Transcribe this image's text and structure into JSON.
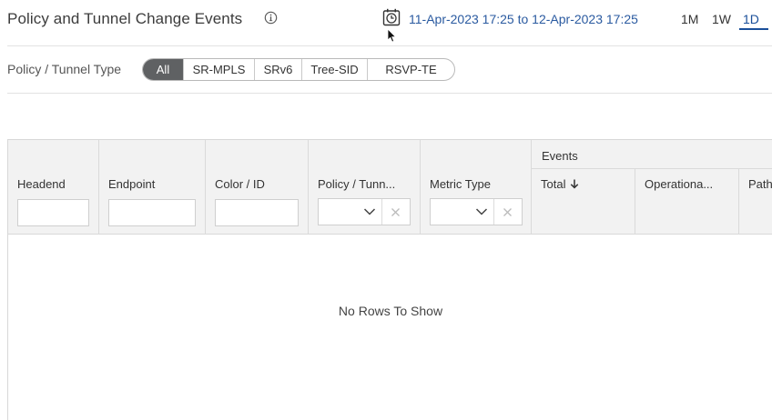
{
  "header": {
    "title": "Policy and Tunnel Change Events",
    "date_range": "11-Apr-2023 17:25 to 12-Apr-2023 17:25",
    "range_buttons": [
      "1M",
      "1W",
      "1D"
    ],
    "active_range": "1D"
  },
  "filter": {
    "label": "Policy / Tunnel Type",
    "options": [
      "All",
      "SR-MPLS",
      "SRv6",
      "Tree-SID",
      "RSVP-TE"
    ],
    "selected": "All"
  },
  "table": {
    "columns": {
      "headend": "Headend",
      "endpoint": "Endpoint",
      "color_id": "Color / ID",
      "policy_type": "Policy / Tunn...",
      "metric_type": "Metric Type"
    },
    "events_group": "Events",
    "event_columns": {
      "total": "Total",
      "operational": "Operationa...",
      "path": "Path"
    },
    "sort": {
      "column": "Total",
      "direction": "descending"
    },
    "empty_message": "No Rows To Show"
  },
  "colors": {
    "accent": "#1a4f9a",
    "link": "#2a5aa0",
    "active_pill": "#5f6163",
    "header_bg": "#f2f2f2"
  },
  "icons": [
    "info-icon",
    "calendar-clock-icon",
    "mouse-cursor",
    "chevron-down-icon",
    "clear-icon",
    "sort-down-arrow-icon"
  ]
}
